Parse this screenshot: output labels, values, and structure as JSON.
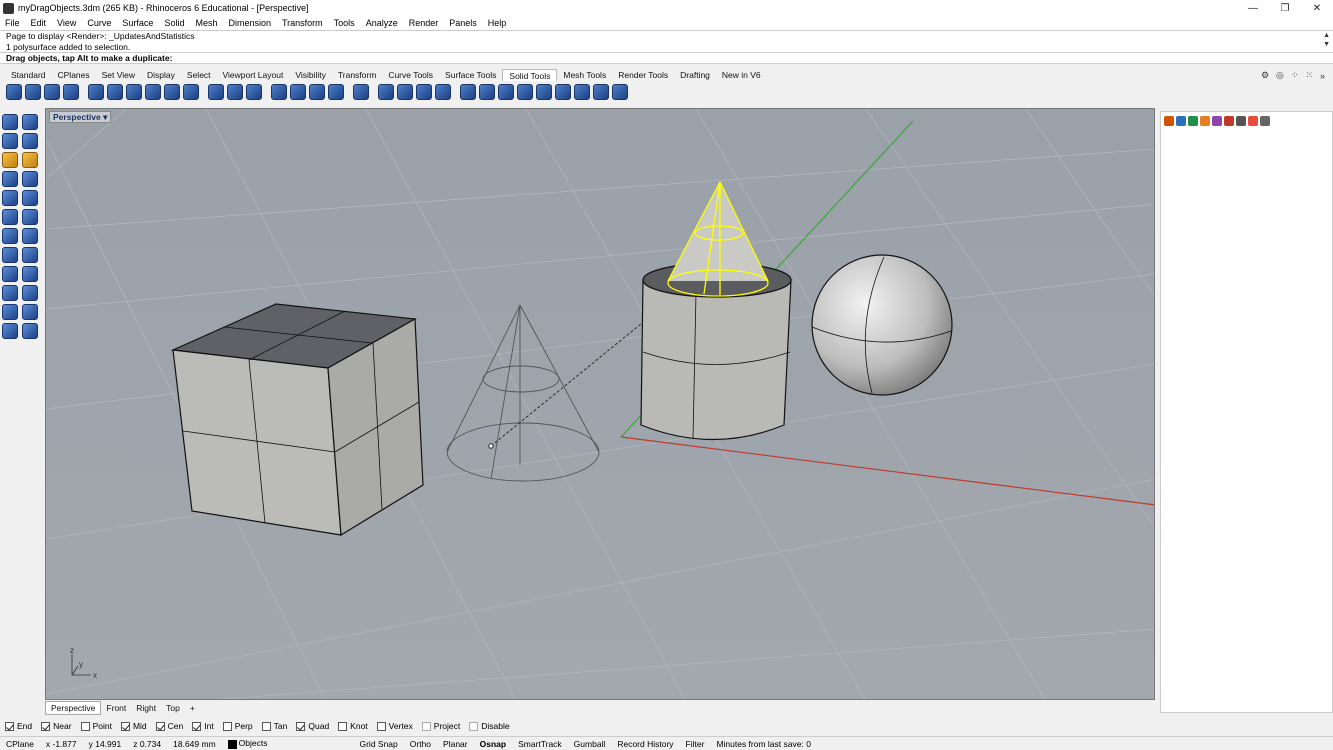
{
  "window": {
    "title": "myDragObjects.3dm (265 KB) - Rhinoceros 6 Educational - [Perspective]",
    "min": "—",
    "max": "❐",
    "close": "✕"
  },
  "menu": [
    "File",
    "Edit",
    "View",
    "Curve",
    "Surface",
    "Solid",
    "Mesh",
    "Dimension",
    "Transform",
    "Tools",
    "Analyze",
    "Render",
    "Panels",
    "Help"
  ],
  "command_history": [
    "Page to display <Render>: _UpdatesAndStatistics",
    "1 polysurface added to selection."
  ],
  "command_prompt": "Drag objects, tap Alt to make a duplicate:",
  "toolbar_tabs": [
    "Standard",
    "CPlanes",
    "Set View",
    "Display",
    "Select",
    "Viewport Layout",
    "Visibility",
    "Transform",
    "Curve Tools",
    "Surface Tools",
    "Solid Tools",
    "Mesh Tools",
    "Render Tools",
    "Drafting",
    "New in V6"
  ],
  "active_tab": "Solid Tools",
  "viewport": {
    "label": "Perspective",
    "dropdown": "▾",
    "axis_x": "x",
    "axis_y": "y",
    "axis_z": "z"
  },
  "viewport_tabs": [
    "Perspective",
    "Front",
    "Right",
    "Top"
  ],
  "viewport_add": "+",
  "osnaps": [
    {
      "label": "End",
      "on": true
    },
    {
      "label": "Near",
      "on": true
    },
    {
      "label": "Point",
      "on": false
    },
    {
      "label": "Mid",
      "on": true
    },
    {
      "label": "Cen",
      "on": true
    },
    {
      "label": "Int",
      "on": true
    },
    {
      "label": "Perp",
      "on": false
    },
    {
      "label": "Tan",
      "on": false
    },
    {
      "label": "Quad",
      "on": true
    },
    {
      "label": "Knot",
      "on": false
    },
    {
      "label": "Vertex",
      "on": false
    },
    {
      "label": "Project",
      "on": false,
      "disabled": true
    },
    {
      "label": "Disable",
      "on": false,
      "disabled": true
    }
  ],
  "status": {
    "cplane": "CPlane",
    "x": "x -1.877",
    "y": "y 14.991",
    "z": "z 0.734",
    "dist": "18.649 mm",
    "layer": "Objects",
    "grid_snap": "Grid Snap",
    "ortho": "Ortho",
    "planar": "Planar",
    "osnap": "Osnap",
    "smarttrack": "SmartTrack",
    "gumball": "Gumball",
    "record_history": "Record History",
    "filter": "Filter",
    "save_msg": "Minutes from last save: 0"
  },
  "colors": {
    "selection": "#ffff00",
    "x_axis": "#c0392b",
    "y_axis": "#3aa63a"
  }
}
